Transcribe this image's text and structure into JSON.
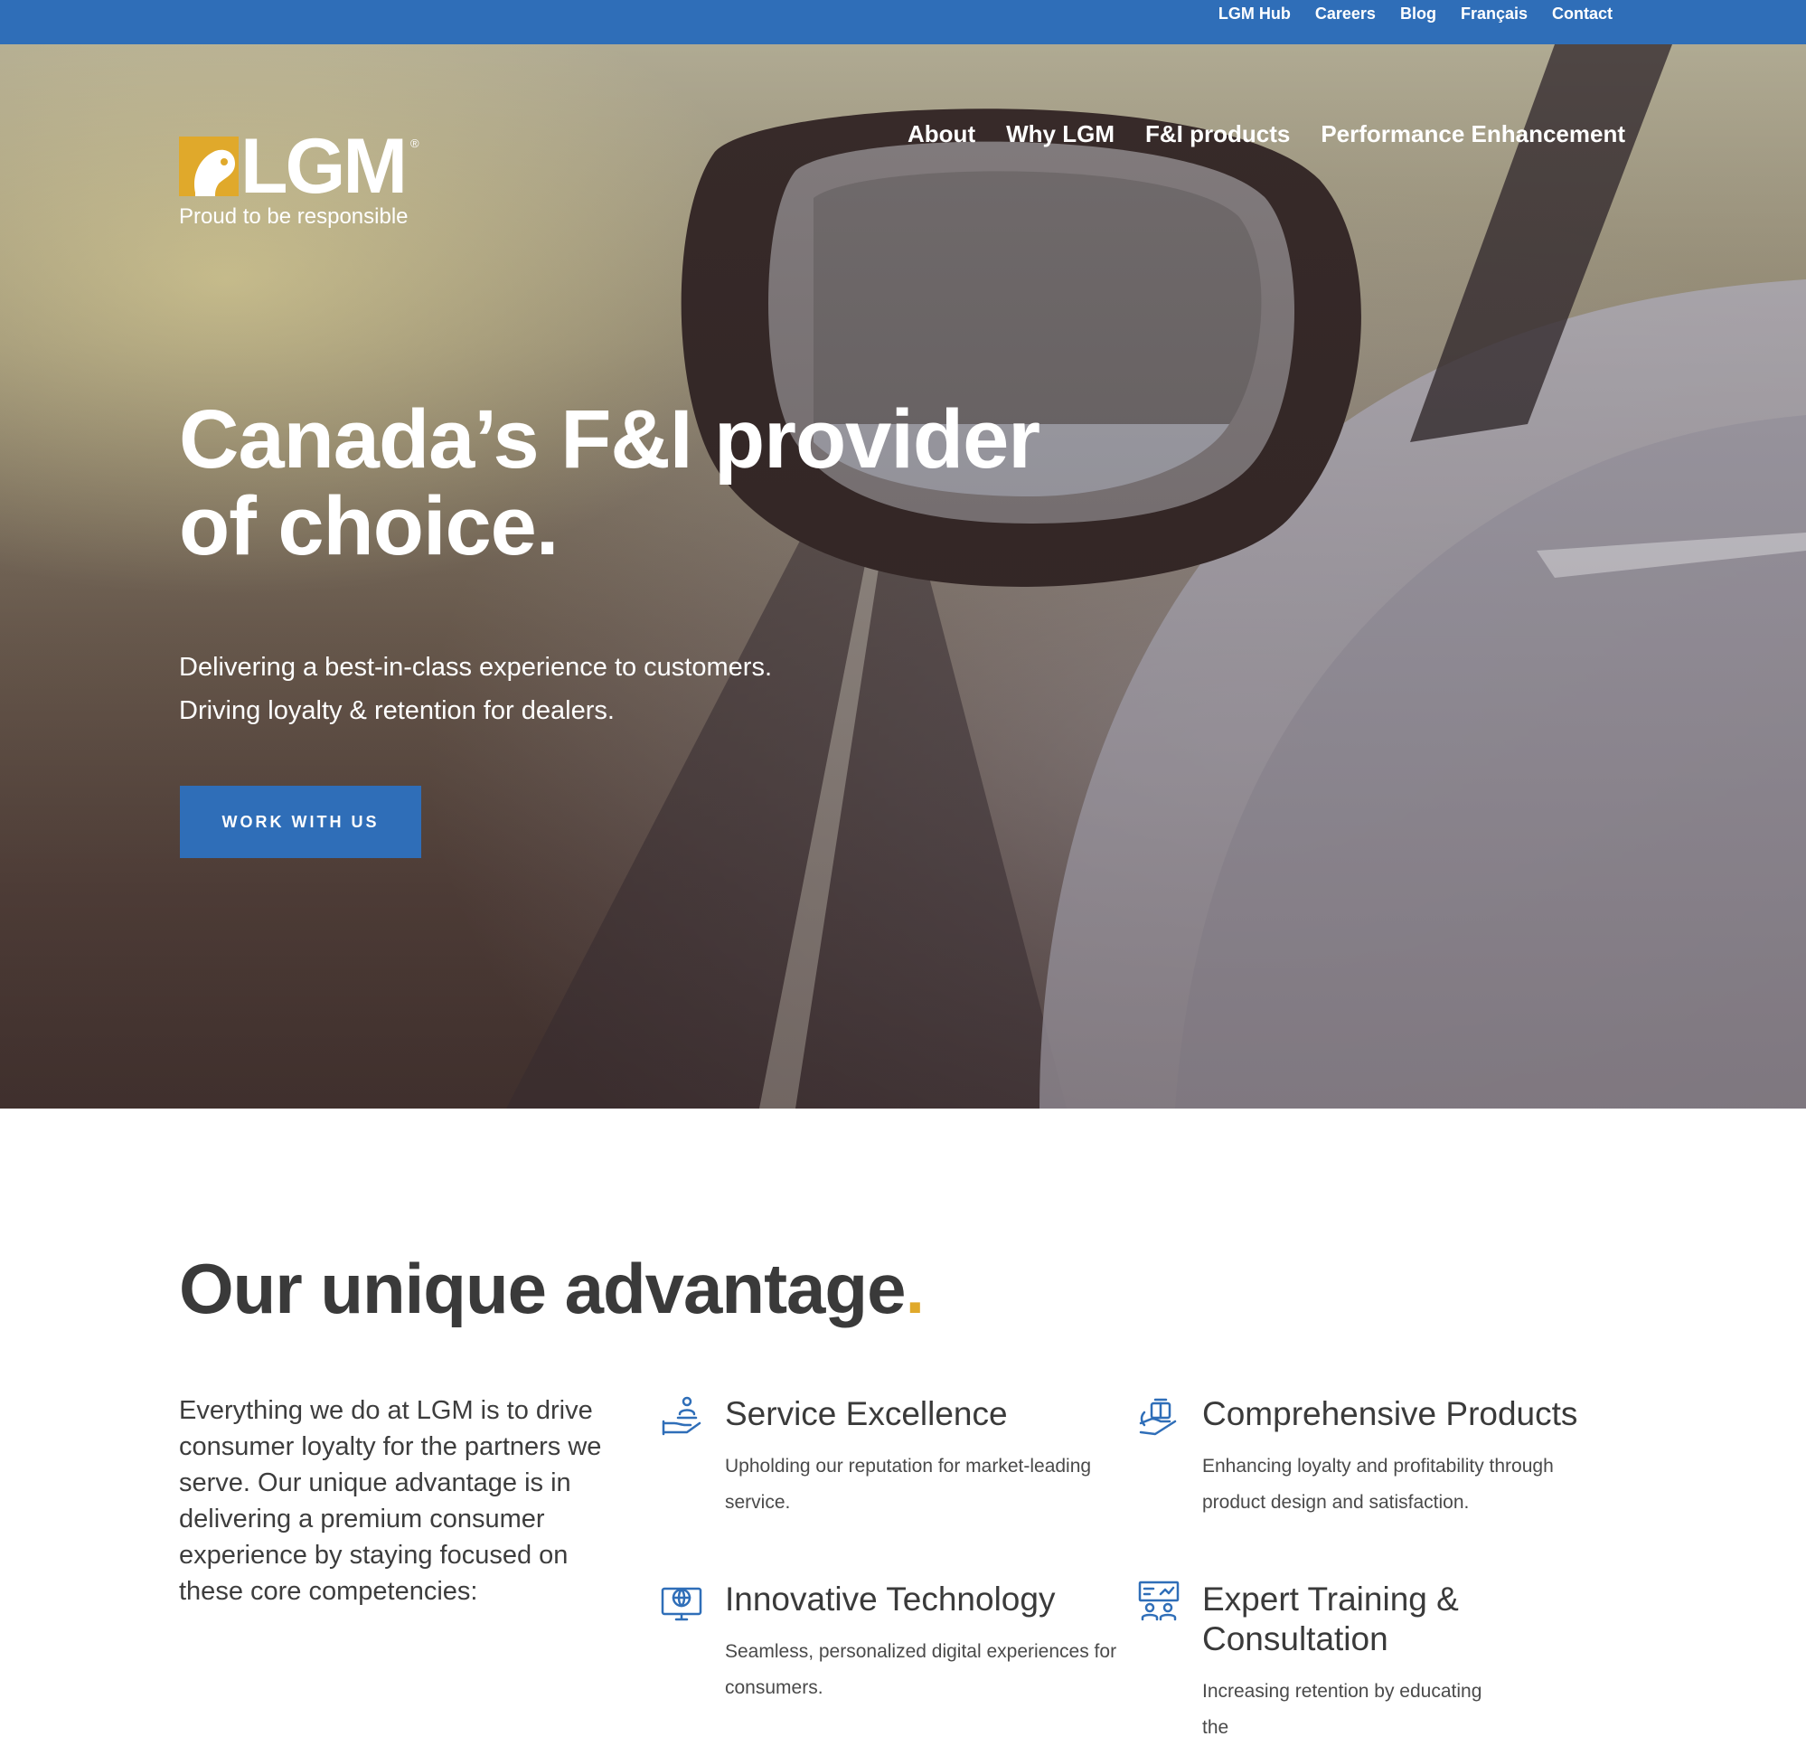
{
  "topbar": {
    "links": [
      "LGM Hub",
      "Careers",
      "Blog",
      "Français",
      "Contact"
    ]
  },
  "header": {
    "logo_text": "LGM",
    "logo_tagline": "Proud to be responsible",
    "nav": [
      "About",
      "Why LGM",
      "F&I products",
      "Performance Enhancement"
    ]
  },
  "hero": {
    "title": "Canada’s F&I provider of choice.",
    "subtitle_line1": "Delivering a best-in-class experience to customers.",
    "subtitle_line2": "Driving loyalty & retention for dealers.",
    "cta_label": "WORK WITH US"
  },
  "advantage": {
    "title": "Our unique advantage",
    "title_dot": ".",
    "intro": "Everything we do at LGM is to drive consumer loyalty for the partners we serve. Our unique advantage is in delivering a premium consumer experience by staying focused on these core competencies:",
    "features": [
      {
        "title": "Service Excellence",
        "text": "Upholding our reputation for market-leading service.",
        "icon": "hand-service-icon"
      },
      {
        "title": "Comprehensive Products",
        "text": "Enhancing loyalty and profitability through product design and satisfaction.",
        "icon": "hand-box-icon"
      },
      {
        "title": "Innovative Technology",
        "text": "Seamless, personalized digital experiences for consumers.",
        "icon": "globe-monitor-icon"
      },
      {
        "title": "Expert Training & Consultation",
        "text": "Increasing retention by educating the",
        "icon": "training-board-icon"
      }
    ]
  },
  "colors": {
    "brand_blue": "#2f6eb8",
    "accent_gold": "#e0a92b",
    "text_dark": "#3a3a3a"
  }
}
